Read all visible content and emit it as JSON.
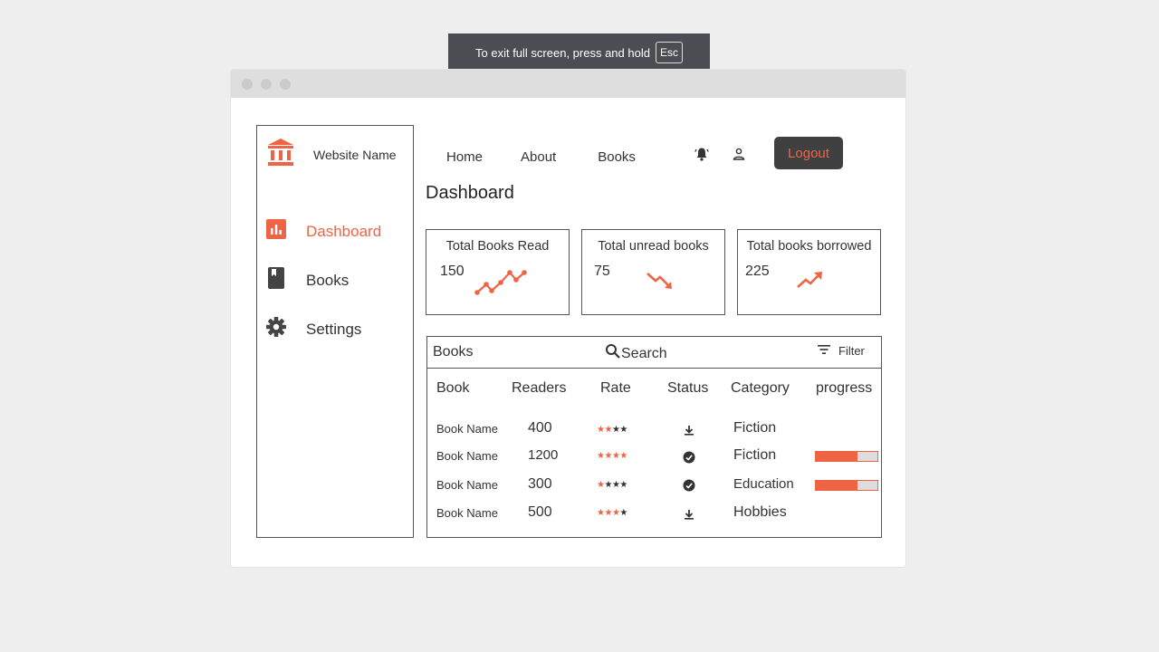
{
  "fullscreen_banner": {
    "text": "To exit full screen, press and hold",
    "key": "Esc"
  },
  "sidebar": {
    "brand_icon": "bank-icon",
    "brand_name": "Website Name",
    "items": [
      {
        "label": "Dashboard",
        "icon": "bar-chart-icon",
        "active": true
      },
      {
        "label": "Books",
        "icon": "book-icon",
        "active": false
      },
      {
        "label": "Settings",
        "icon": "gear-icon",
        "active": false
      }
    ]
  },
  "topnav": {
    "links": [
      "Home",
      "About",
      "Books"
    ],
    "icons": [
      "notification-bell-icon",
      "user-icon"
    ],
    "logout_label": "Logout"
  },
  "page_title": "Dashboard",
  "cards": [
    {
      "title": "Total Books Read",
      "value": "150",
      "trend": "up-line-chart-icon"
    },
    {
      "title": "Total unread books",
      "value": "75",
      "trend": "trending-down-icon"
    },
    {
      "title": "Total books borrowed",
      "value": "225",
      "trend": "trending-up-icon"
    }
  ],
  "books_panel": {
    "title": "Books",
    "search_label": "Search",
    "filter_label": "Filter",
    "columns": [
      "Book",
      "Readers",
      "Rate",
      "Status",
      "Category",
      "progress"
    ],
    "rows": [
      {
        "name": "Book Name",
        "readers": "400",
        "rating": 2,
        "status": "download-icon",
        "category": "Fiction",
        "progress": null
      },
      {
        "name": "Book Name",
        "readers": "1200",
        "rating": 4,
        "status": "check-circle-icon",
        "category": "Fiction",
        "progress": 0.68
      },
      {
        "name": "Book Name",
        "readers": "300",
        "rating": 1,
        "status": "check-circle-icon",
        "category": "Education",
        "progress": 0.68
      },
      {
        "name": "Book Name",
        "readers": "500",
        "rating": 3,
        "status": "download-icon",
        "category": "Hobbies",
        "progress": null
      }
    ]
  },
  "colors": {
    "accent": "#ef6445",
    "dark": "#404040",
    "border": "#555555"
  }
}
